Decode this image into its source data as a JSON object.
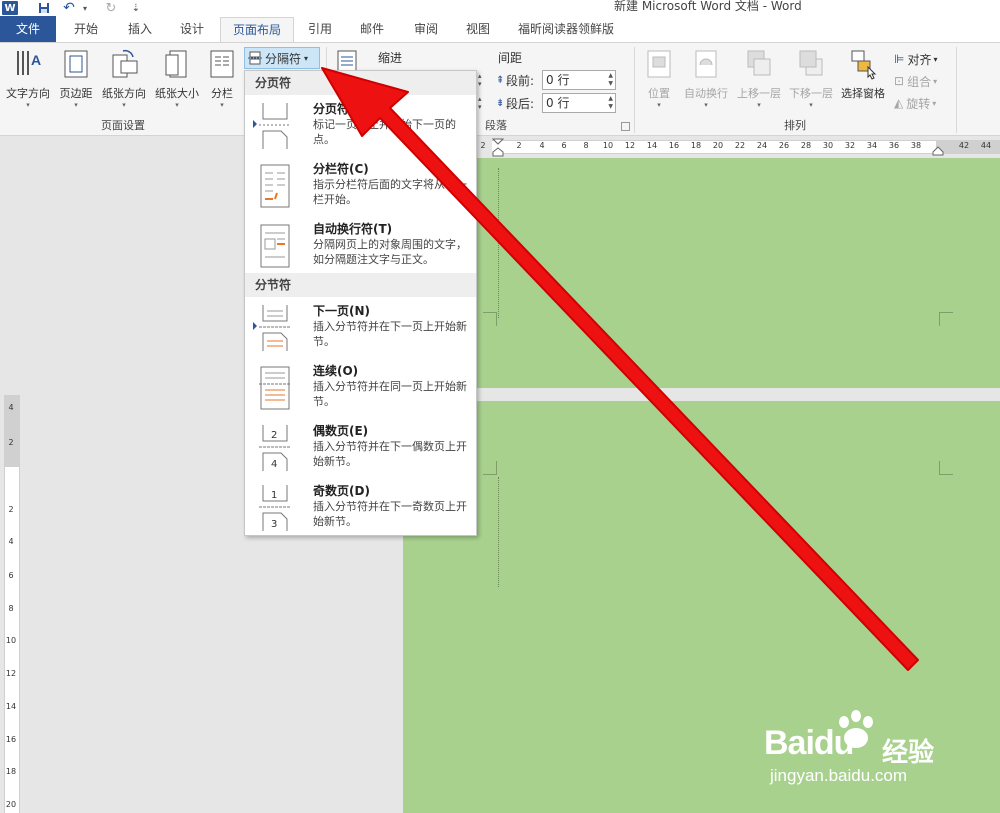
{
  "window": {
    "title": "新建 Microsoft Word 文档 - Word",
    "quick_access": {
      "app_icon": "W",
      "undo_glyph": "↶",
      "redo_glyph": "↻",
      "customize_glyph": "⇣"
    }
  },
  "tabs": [
    {
      "label": "文件"
    },
    {
      "label": "开始"
    },
    {
      "label": "插入"
    },
    {
      "label": "设计"
    },
    {
      "label": "页面布局"
    },
    {
      "label": "引用"
    },
    {
      "label": "邮件"
    },
    {
      "label": "审阅"
    },
    {
      "label": "视图"
    },
    {
      "label": "福昕阅读器领鲜版"
    }
  ],
  "ribbon": {
    "page_setup": {
      "label": "页面设置",
      "buttons": [
        {
          "label": "文字方向",
          "icon": "text-direction-icon"
        },
        {
          "label": "页边距",
          "icon": "margins-icon"
        },
        {
          "label": "纸张方向",
          "icon": "orientation-icon"
        },
        {
          "label": "纸张大小",
          "icon": "size-icon"
        },
        {
          "label": "分栏",
          "icon": "columns-icon"
        }
      ],
      "breaks_label": "分隔符",
      "dropdown_glyph": "▾"
    },
    "paragraph": {
      "label": "段落",
      "indent_label": "缩进",
      "spacing_label": "间距",
      "before_label": "段前:",
      "before_value": "0 行",
      "after_label": "段后:",
      "after_value": "0 行"
    },
    "arrange": {
      "label": "排列",
      "buttons": [
        {
          "label": "位置",
          "icon": "position-icon"
        },
        {
          "label": "自动换行",
          "icon": "wrap-text-icon"
        },
        {
          "label": "上移一层",
          "icon": "bring-forward-icon"
        },
        {
          "label": "下移一层",
          "icon": "send-backward-icon"
        },
        {
          "label": "选择窗格",
          "icon": "selection-pane-icon"
        }
      ],
      "align": "对齐",
      "group": "组合",
      "rotate": "旋转"
    }
  },
  "ruler": {
    "horizontal": [
      "2",
      "2",
      "4",
      "6",
      "8",
      "10",
      "12",
      "14",
      "16",
      "18",
      "20",
      "22",
      "24",
      "26",
      "28",
      "30",
      "32",
      "34",
      "36",
      "38",
      "42",
      "44"
    ],
    "vertical": [
      "4",
      "2",
      "2",
      "4",
      "6",
      "8",
      "10",
      "12",
      "14",
      "16",
      "18",
      "20"
    ],
    "tab_selector": "L"
  },
  "breaks_menu": {
    "page_breaks_header": "分页符",
    "section_breaks_header": "分节符",
    "items": [
      {
        "title": "分页符(P)",
        "desc": "标记一页终止并开始下一页的点。",
        "icon": "page-break-icon"
      },
      {
        "title": "分栏符(C)",
        "desc": "指示分栏符后面的文字将从下一栏开始。",
        "icon": "column-break-icon"
      },
      {
        "title": "自动换行符(T)",
        "desc": "分隔网页上的对象周围的文字，如分隔题注文字与正文。",
        "icon": "text-wrapping-break-icon"
      },
      {
        "title": "下一页(N)",
        "desc": "插入分节符并在下一页上开始新节。",
        "icon": "next-page-section-icon"
      },
      {
        "title": "连续(O)",
        "desc": "插入分节符并在同一页上开始新节。",
        "icon": "continuous-section-icon"
      },
      {
        "title": "偶数页(E)",
        "desc": "插入分节符并在下一偶数页上开始新节。",
        "icon": "even-page-section-icon"
      },
      {
        "title": "奇数页(D)",
        "desc": "插入分节符并在下一奇数页上开始新节。",
        "icon": "odd-page-section-icon"
      }
    ]
  },
  "watermark": {
    "logo": "Baidu",
    "name": "经验",
    "url": "jingyan.baidu.com"
  },
  "colors": {
    "accent": "#2b579a",
    "page": "#a9d18e",
    "arrow": "#ee1111",
    "menu_highlight": "#cde6f7"
  }
}
